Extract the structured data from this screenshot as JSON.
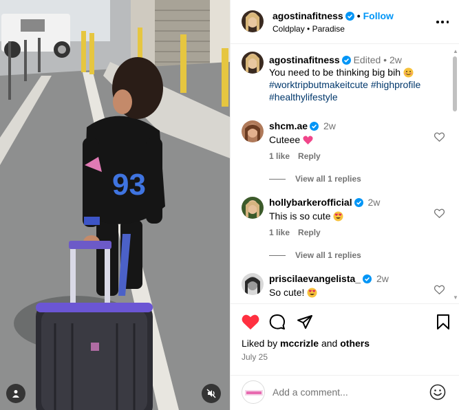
{
  "post": {
    "author": "agostinafitness",
    "follow_label": "Follow",
    "audio": {
      "artist": "Coldplay",
      "song": "Paradise"
    },
    "caption": {
      "edited_label": "Edited",
      "time": "2w",
      "text": "You need to be thinking big bih",
      "hashtags": [
        "#worktripbutmakeitcute",
        "#highprofile",
        "#healthylifestyle"
      ]
    },
    "comments": [
      {
        "username": "shcm.ae",
        "time": "2w",
        "text": "Cuteee",
        "emoji": "pink-heart",
        "likes_label": "1 like",
        "reply_label": "Reply",
        "view_replies_label": "View all 1 replies"
      },
      {
        "username": "hollybarkerofficial",
        "time": "2w",
        "text": "This is so cute",
        "emoji": "heart-eyes",
        "likes_label": "1 like",
        "reply_label": "Reply",
        "view_replies_label": "View all 1 replies"
      },
      {
        "username": "priscilaevangelista_",
        "time": "2w",
        "text": "So cute!",
        "emoji": "heart-eyes"
      }
    ],
    "liked_by": {
      "prefix": "Liked by",
      "user": "mccrizle",
      "conjunction": "and",
      "others": "others"
    },
    "date": "July 25",
    "add_comment_placeholder": "Add a comment...",
    "colors": {
      "link_blue": "#0095f6",
      "hashtag_blue": "#00376b",
      "like_red": "#ff3040",
      "secondary_text": "#737373",
      "verified_blue": "#0095f6"
    },
    "icons": [
      "verified-badge-icon",
      "more-options-icon",
      "heart-icon",
      "comment-icon",
      "share-icon",
      "save-icon",
      "emoji-icon",
      "tag-user-icon",
      "mute-icon"
    ]
  }
}
